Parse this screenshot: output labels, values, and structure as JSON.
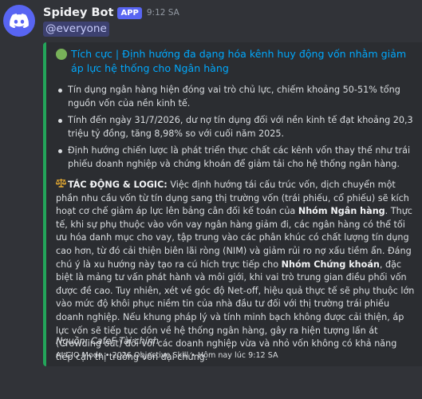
{
  "message": {
    "author": "Spidey Bot",
    "app_badge": "APP",
    "timestamp": "9:12 SA",
    "mention": "@everyone",
    "avatar_icon": "discord-logo-icon",
    "colors": {
      "accent": "#5865f2",
      "embed_bar": "#23a55a",
      "link": "#00a8fc"
    }
  },
  "embed": {
    "status_icon": "green-circle-icon",
    "title": "Tích cực | Định hướng đa dạng hóa kênh huy động vốn nhằm giảm áp lực hệ thống cho Ngân hàng",
    "bullets": [
      "Tín dụng ngân hàng hiện đóng vai trò chủ lực, chiếm khoảng 50-51% tổng nguồn vốn của nền kinh tế.",
      "Tính đến ngày 31/7/2026, dư nợ tín dụng đối với nền kinh tế đạt khoảng 20,3 triệu tỷ đồng, tăng 8,98% so với cuối năm 2025.",
      "Định hướng chiến lược là phát triển thực chất các kênh vốn thay thế như trái phiếu doanh nghiệp và chứng khoán để giảm tải cho hệ thống ngân hàng."
    ],
    "impact": {
      "icon": "balance-scale-icon",
      "label": "TÁC ĐỘNG & LOGIC:",
      "text_1": " Việc định hướng tái cấu trúc vốn, dịch chuyển một phần nhu cầu vốn từ tín dụng sang thị trường vốn (trái phiếu, cổ phiếu) sẽ kích hoạt cơ chế giảm áp lực lên bảng cân đối kế toán của ",
      "bold_1": "Nhóm Ngân hàng",
      "text_2": ". Thực tế, khi sự phụ thuộc vào vốn vay ngân hàng giảm đi, các ngân hàng có thể tối ưu hóa danh mục cho vay, tập trung vào các phân khúc có chất lượng tín dụng cao hơn, từ đó cải thiện biên lãi ròng (NIM) và giảm rủi ro nợ xấu tiềm ẩn. Đáng chú ý là xu hướng này tạo ra cú hích trực tiếp cho ",
      "bold_2": "Nhóm Chứng khoán",
      "text_3": ", đặc biệt là mảng tư vấn phát hành và môi giới, khi vai trò trung gian điều phối vốn được đề cao. Tuy nhiên, xét về góc độ Net-off, hiệu quả thực tế sẽ phụ thuộc lớn vào mức độ khôi phục niềm tin của nhà đầu tư đối với thị trường trái phiếu doanh nghiệp. Nếu khung pháp lý và tính minh bạch không được cải thiện, áp lực vốn sẽ tiếp tục dồn về hệ thống ngân hàng, gây ra hiện tượng lấn át (Crowding out) đối với các doanh nghiệp vừa và nhỏ vốn không có khả năng tiếp cận thị trường vốn đại chúng."
    },
    "source": "Nguồn: CafeF Tài chính",
    "footer": "AI CIO Mode • 2026 Objective Skill • Hôm nay lúc 9:12 SA"
  }
}
